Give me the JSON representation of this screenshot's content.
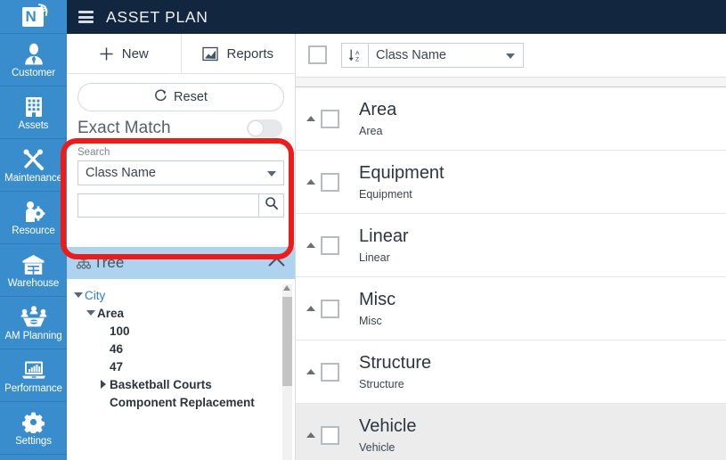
{
  "brand": {
    "logo_letter": "N",
    "logo_accent": "G",
    "rail_color": "#3a8dcc",
    "header_color": "#12263f",
    "highlight_color": "#ee1b1b"
  },
  "sidebar": {
    "items": [
      {
        "label": "Customer",
        "icon": "user-tie-icon"
      },
      {
        "label": "Assets",
        "icon": "building-icon"
      },
      {
        "label": "Maintenance",
        "icon": "tools-icon"
      },
      {
        "label": "Resource",
        "icon": "person-gear-icon"
      },
      {
        "label": "Warehouse",
        "icon": "warehouse-icon"
      },
      {
        "label": "AM Planning",
        "icon": "meeting-table-icon"
      },
      {
        "label": "Performance",
        "icon": "laptop-chart-icon"
      },
      {
        "label": "Settings",
        "icon": "gear-icon"
      }
    ]
  },
  "header": {
    "menu_icon": "hamburger-icon",
    "title": "ASSET PLAN"
  },
  "toolbar": {
    "new_label": "New",
    "new_icon": "plus-icon",
    "reports_label": "Reports",
    "reports_icon": "chart-icon"
  },
  "search_panel": {
    "reset_label": "Reset",
    "reset_icon": "refresh-icon",
    "exact_match_label": "Exact Match",
    "exact_match_on": false,
    "search_label": "Search",
    "field_select_value": "Class Name",
    "field_select_icon": "chevron-down-icon",
    "query_value": "",
    "query_placeholder": "",
    "search_icon": "search-icon"
  },
  "tree": {
    "title": "Tree",
    "icon": "sitemap-icon",
    "collapse_icon": "chevron-up-icon",
    "nodes": [
      {
        "label": "City",
        "depth": 0,
        "expander": "down",
        "style": "link"
      },
      {
        "label": "Area",
        "depth": 1,
        "expander": "down",
        "style": "bold"
      },
      {
        "label": "100",
        "depth": 2,
        "expander": "none",
        "style": "bold"
      },
      {
        "label": "46",
        "depth": 2,
        "expander": "none",
        "style": "bold"
      },
      {
        "label": "47",
        "depth": 2,
        "expander": "none",
        "style": "bold"
      },
      {
        "label": "Basketball Courts",
        "depth": 2,
        "expander": "right",
        "style": "bold"
      },
      {
        "label": "Component Replacement",
        "depth": 2,
        "expander": "none",
        "style": "bold"
      }
    ]
  },
  "list": {
    "select_all_checked": false,
    "sort_icon": "sort-alpha-asc-icon",
    "sort_value": "Class Name",
    "sort_caret_icon": "chevron-down-icon",
    "rows": [
      {
        "title": "Area",
        "subtitle": "Area",
        "checked": false,
        "highlighted": false
      },
      {
        "title": "Equipment",
        "subtitle": "Equipment",
        "checked": false,
        "highlighted": false
      },
      {
        "title": "Linear",
        "subtitle": "Linear",
        "checked": false,
        "highlighted": false
      },
      {
        "title": "Misc",
        "subtitle": "Misc",
        "checked": false,
        "highlighted": false
      },
      {
        "title": "Structure",
        "subtitle": "Structure",
        "checked": false,
        "highlighted": false
      },
      {
        "title": "Vehicle",
        "subtitle": "Vehicle",
        "checked": false,
        "highlighted": true
      }
    ]
  },
  "annotation": {
    "type": "red-rounded-rectangle-highlight",
    "target": "search-panel"
  }
}
